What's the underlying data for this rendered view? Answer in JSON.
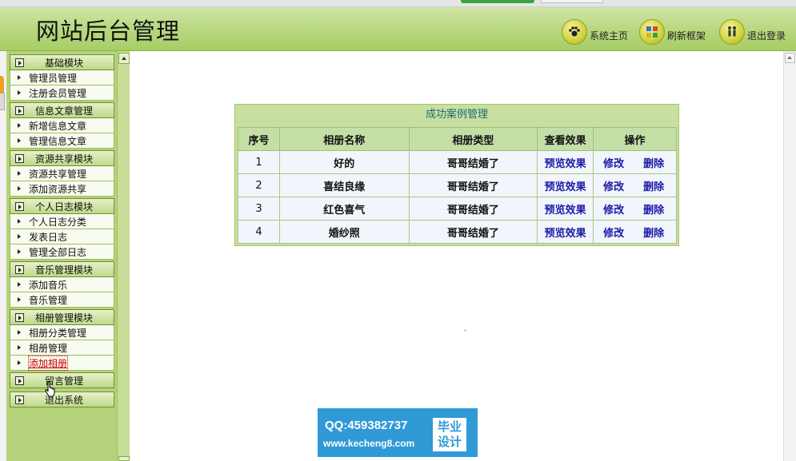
{
  "header": {
    "title": "网站后台管理",
    "nav": [
      {
        "label": "系统主页",
        "icon": "paw-icon"
      },
      {
        "label": "刷新框架",
        "icon": "grid-icon"
      },
      {
        "label": "退出登录",
        "icon": "people-icon"
      }
    ]
  },
  "sidebar": {
    "groups": [
      {
        "title": "基础模块",
        "items": [
          "管理员管理",
          "注册会员管理"
        ]
      },
      {
        "title": "信息文章管理",
        "items": [
          "新增信息文章",
          "管理信息文章"
        ]
      },
      {
        "title": "资源共享模块",
        "items": [
          "资源共享管理",
          "添加资源共享"
        ]
      },
      {
        "title": "个人日志模块",
        "items": [
          "个人日志分类",
          "发表日志",
          "管理全部日志"
        ]
      },
      {
        "title": "音乐管理模块",
        "items": [
          "添加音乐",
          "音乐管理"
        ]
      },
      {
        "title": "相册管理模块",
        "items": [
          "相册分类管理",
          "相册管理",
          "添加相册"
        ]
      },
      {
        "title": "留言管理",
        "items": []
      },
      {
        "title": "退出系统",
        "items": []
      }
    ]
  },
  "main": {
    "caption": "成功案例管理",
    "columns": [
      "序号",
      "相册名称",
      "相册类型",
      "查看效果",
      "操作"
    ],
    "rows": [
      {
        "no": "1",
        "name": "好的",
        "type": "哥哥结婚了",
        "preview": "预览效果",
        "edit": "修改",
        "delete": "删除"
      },
      {
        "no": "2",
        "name": "喜结良缘",
        "type": "哥哥结婚了",
        "preview": "预览效果",
        "edit": "修改",
        "delete": "删除"
      },
      {
        "no": "3",
        "name": "红色喜气",
        "type": "哥哥结婚了",
        "preview": "预览效果",
        "edit": "修改",
        "delete": "删除"
      },
      {
        "no": "4",
        "name": "婚纱照",
        "type": "哥哥结婚了",
        "preview": "预览效果",
        "edit": "修改",
        "delete": "删除"
      }
    ]
  },
  "watermark": {
    "qq": "QQ:459382737",
    "url": "www.kecheng8.com",
    "seal_line1": "毕业",
    "seal_line2": "设计"
  },
  "colors": {
    "header_green": "#b7d77d",
    "link_blue": "#1a1aa8",
    "caption_teal": "#1c6a78",
    "watermark_blue": "#2f9ad6"
  }
}
